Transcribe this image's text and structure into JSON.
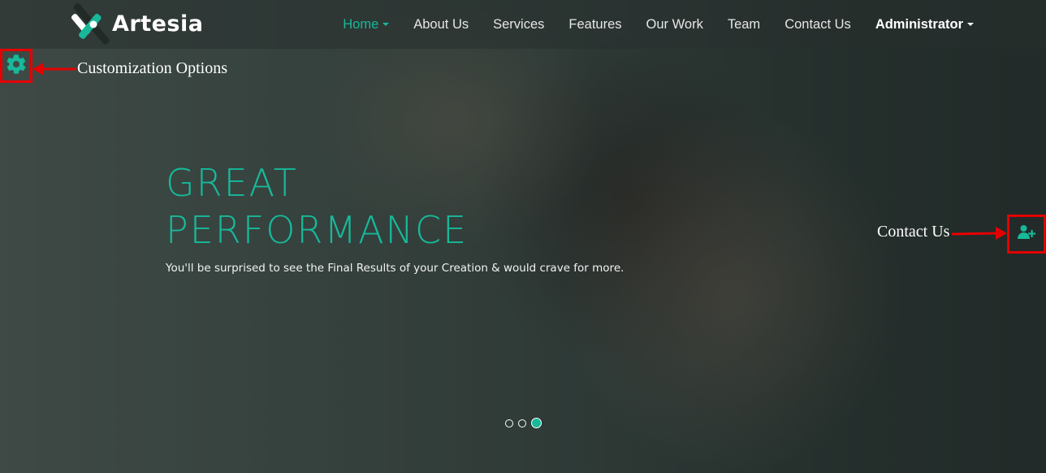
{
  "brand": {
    "name": "Artesia"
  },
  "nav": {
    "items": [
      {
        "label": "Home",
        "active": true,
        "dropdown": true
      },
      {
        "label": "About Us"
      },
      {
        "label": "Services"
      },
      {
        "label": "Features"
      },
      {
        "label": "Our Work"
      },
      {
        "label": "Team"
      },
      {
        "label": "Contact Us"
      },
      {
        "label": "Administrator",
        "dropdown": true
      }
    ]
  },
  "hero": {
    "title_line1": "GREAT",
    "title_line2": "PERFORMANCE",
    "subtitle": "You'll be surprised to see the Final Results of your Creation & would crave for more.",
    "slides": {
      "count": 3,
      "active_index": 2
    }
  },
  "annotations": {
    "customization_label": "Customization Options",
    "contact_label": "Contact Us"
  },
  "icons": {
    "customization": "gear-icon",
    "contact": "user-plus-icon"
  },
  "colors": {
    "accent": "#17b99a",
    "annotation": "#e50000"
  }
}
